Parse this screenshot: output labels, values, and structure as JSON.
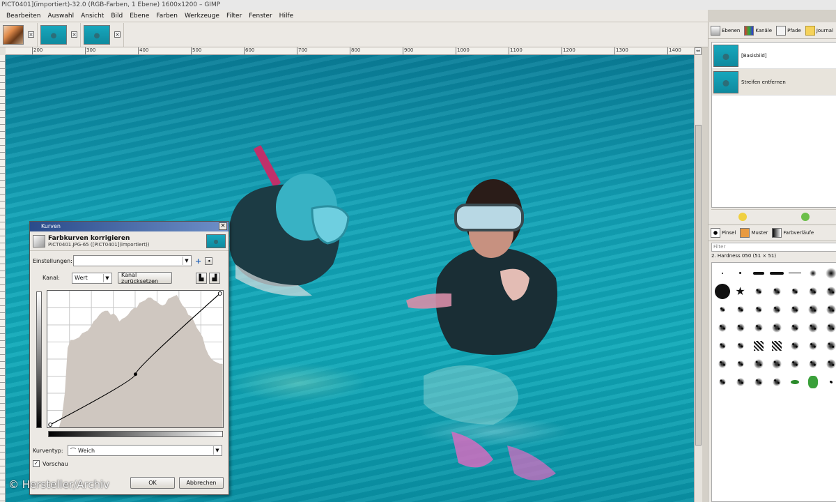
{
  "window": {
    "title": "PICT0401](importiert)-32.0 (RGB-Farben, 1 Ebene) 1600x1200 – GIMP"
  },
  "menu": [
    "Bearbeiten",
    "Auswahl",
    "Ansicht",
    "Bild",
    "Ebene",
    "Farben",
    "Werkzeuge",
    "Filter",
    "Fenster",
    "Hilfe"
  ],
  "ruler": {
    "labels": [
      "200",
      "300",
      "400",
      "500",
      "600",
      "700",
      "800",
      "900",
      "1000",
      "1100",
      "1200",
      "1300",
      "1400"
    ]
  },
  "dock": {
    "tabs": [
      "Ebenen",
      "Kanäle",
      "Pfade",
      "Journal"
    ],
    "layers": [
      "[Basisbild]",
      "Streifen entfernen"
    ],
    "brush_tabs": [
      "Pinsel",
      "Muster",
      "Farbverläufe"
    ],
    "filter_placeholder": "Filter",
    "brush_name": "2. Hardness 050 (51 × 51)"
  },
  "dialog": {
    "title": "Kurven",
    "header_title": "Farbkurven korrigieren",
    "header_subtitle": "PICT0401.JPG-65 ([PICT0401](importiert))",
    "presets_label": "Einstellungen:",
    "channel_label": "Kanal:",
    "channel_value": "Wert",
    "reset_channel": "Kanal zurücksetzen",
    "curve_type_label": "Kurventyp:",
    "curve_type_value": "Weich",
    "preview_label": "Vorschau",
    "ok": "OK",
    "cancel": "Abbrechen"
  },
  "curve_data": {
    "type": "curve",
    "points": [
      [
        0,
        0
      ],
      [
        128,
        98
      ],
      [
        255,
        255
      ]
    ],
    "histogram": [
      0,
      0,
      0,
      0,
      0,
      8,
      26,
      60,
      66,
      66,
      67,
      68,
      71,
      72,
      73,
      76,
      80,
      82,
      85,
      87,
      88,
      88,
      85,
      86,
      84,
      80,
      82,
      83,
      85,
      88,
      90,
      90,
      94,
      95,
      96,
      98,
      98,
      96,
      95,
      93,
      92,
      93,
      97,
      98,
      99,
      100,
      96,
      92,
      90,
      85,
      84,
      80,
      75,
      72,
      68,
      60,
      55,
      52,
      50,
      49,
      48,
      48
    ]
  },
  "colors": {
    "accent": "#2a4b8a",
    "water": "#12a2b6"
  },
  "watermark": "© Hersteller/Archiv"
}
